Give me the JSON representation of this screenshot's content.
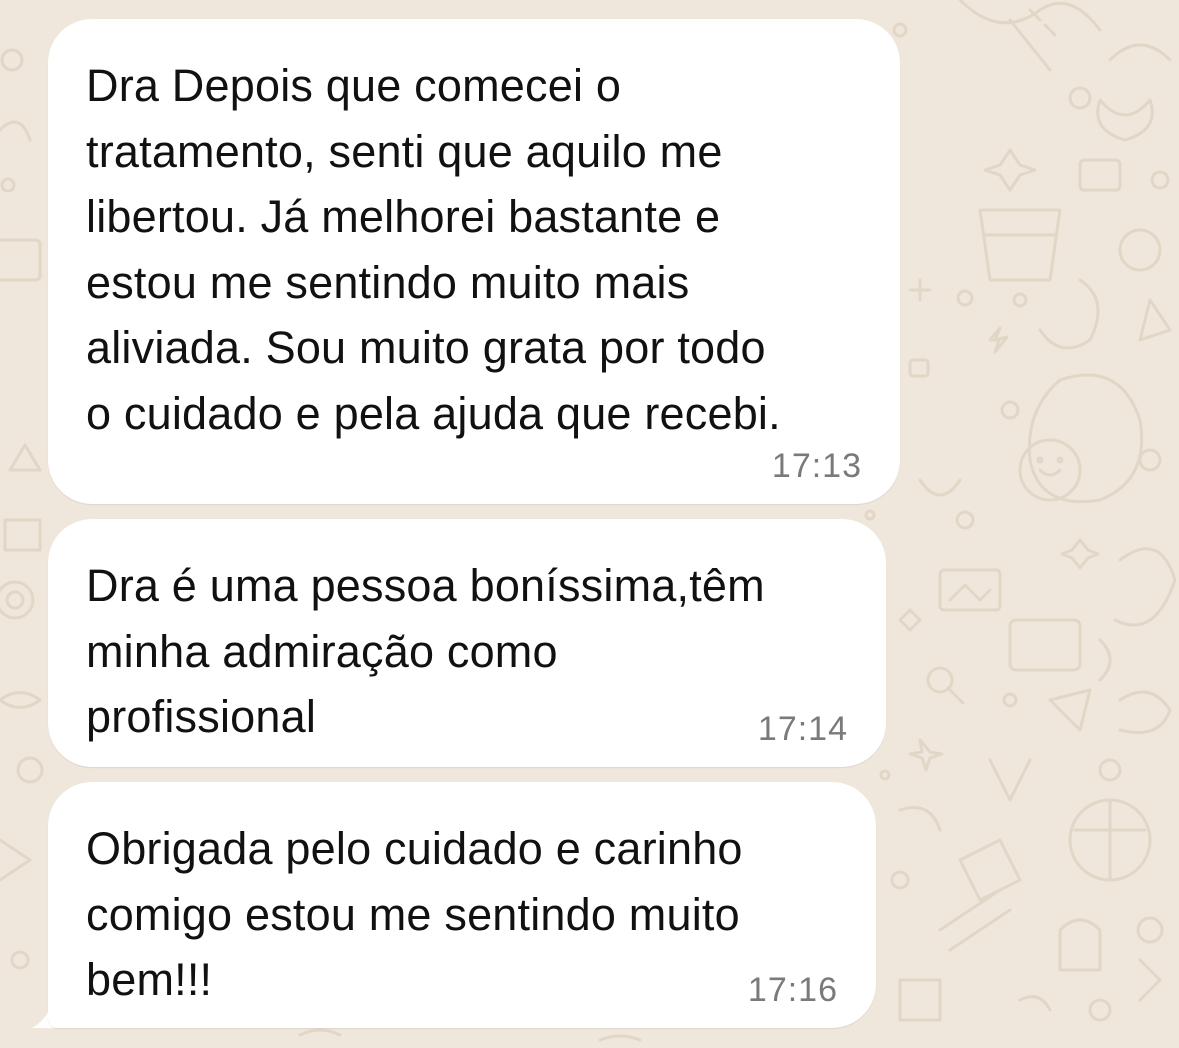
{
  "theme": {
    "wallpaper_color": "#efe7dc",
    "doodle_color": "#e2d7c6",
    "bubble_color": "#ffffff",
    "text_color": "#111111",
    "time_color": "#7a7a7a"
  },
  "messages": [
    {
      "text": "Dra Depois que comecei o\ntratamento, senti que aquilo me\nlibertou. Já melhorei bastante e\nestou me sentindo muito mais\naliviada. Sou muito grata por todo\no cuidado e pela ajuda que recebi.",
      "time": "17:13"
    },
    {
      "text": "Dra é uma pessoa boníssima,têm\nminha admiração como\nprofissional",
      "time": "17:14"
    },
    {
      "text": "Obrigada pelo cuidado e carinho\ncomigo estou me sentindo muito\nbem!!!",
      "time": "17:16"
    }
  ]
}
